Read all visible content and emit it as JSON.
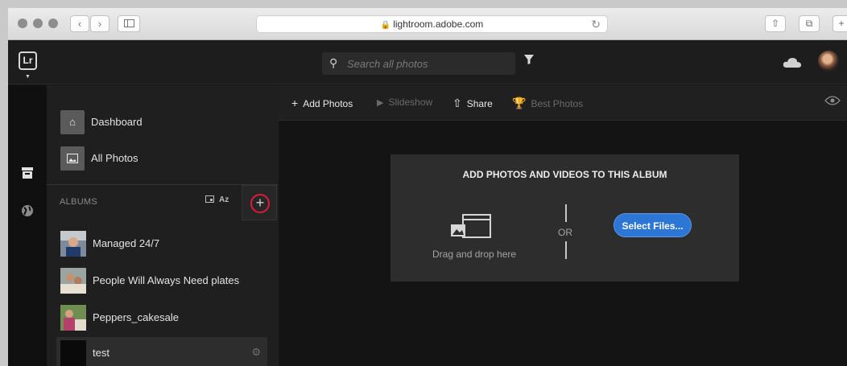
{
  "browser": {
    "url": "lightroom.adobe.com",
    "nav_back": "‹",
    "nav_forward": "›"
  },
  "app": {
    "logo": "Lr",
    "search": {
      "placeholder": "Search all photos"
    }
  },
  "sidebar": {
    "items": [
      {
        "label": "Dashboard",
        "icon": "home-icon"
      },
      {
        "label": "All Photos",
        "icon": "photo-icon"
      }
    ],
    "albums_header": "ALBUMS",
    "sort_label": "Az",
    "albums": [
      {
        "label": "Managed 24/7"
      },
      {
        "label": "People Will Always Need plates"
      },
      {
        "label": "Peppers_cakesale"
      },
      {
        "label": "test"
      }
    ]
  },
  "toolbar": {
    "add_photos": "Add Photos",
    "slideshow": "Slideshow",
    "share": "Share",
    "best_photos": "Best Photos"
  },
  "drop_panel": {
    "title": "ADD PHOTOS AND VIDEOS TO THIS ALBUM",
    "drag_text": "Drag and drop here",
    "or_text": "OR",
    "button": "Select Files..."
  },
  "colors": {
    "accent_blue": "#2c76d6",
    "highlight_red": "#e01a3a"
  }
}
